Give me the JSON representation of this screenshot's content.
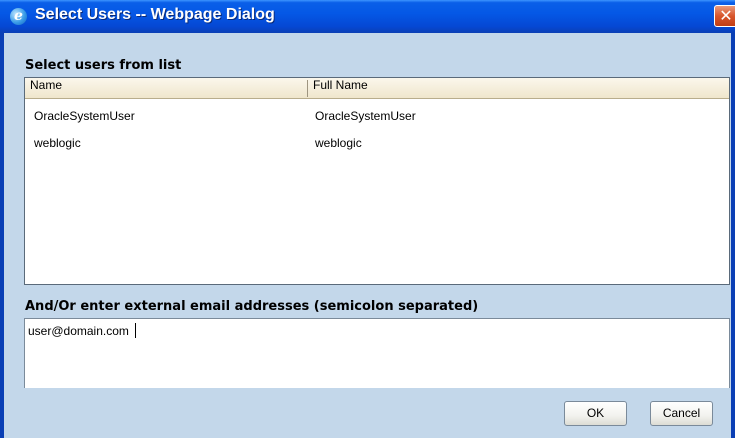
{
  "window": {
    "title": "Select Users -- Webpage Dialog",
    "close_glyph": "✕"
  },
  "user_list": {
    "label": "Select users from list",
    "columns": [
      "Name",
      "Full Name"
    ],
    "rows": [
      {
        "name": "OracleSystemUser",
        "full_name": "OracleSystemUser"
      },
      {
        "name": "weblogic",
        "full_name": "weblogic"
      }
    ]
  },
  "email": {
    "label": "And/Or enter external email addresses (semicolon separated)",
    "value": "user@domain.com"
  },
  "buttons": {
    "ok": "OK",
    "cancel": "Cancel"
  },
  "icons": {
    "app": "internet-explorer-icon",
    "app_glyph": "e",
    "close": "close-icon"
  },
  "colors": {
    "title_bar": "#0558e6",
    "client_bg": "#c3d7ea",
    "close_button": "#d8552c"
  }
}
